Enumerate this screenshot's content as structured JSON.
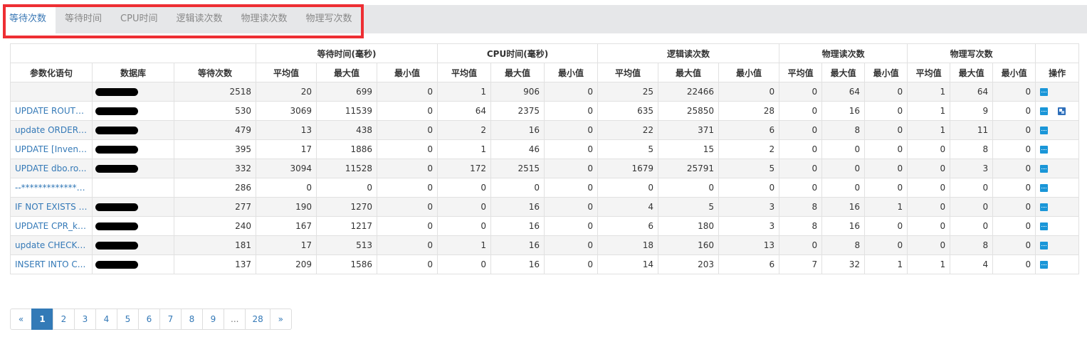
{
  "tabs": [
    {
      "label": "等待次数",
      "active": true
    },
    {
      "label": "等待时间",
      "active": false
    },
    {
      "label": "CPU时间",
      "active": false
    },
    {
      "label": "逻辑读次数",
      "active": false
    },
    {
      "label": "物理读次数",
      "active": false
    },
    {
      "label": "物理写次数",
      "active": false
    }
  ],
  "table": {
    "group_headers": {
      "wait_time": "等待时间(毫秒)",
      "cpu_time": "CPU时间(毫秒)",
      "logical_reads": "逻辑读次数",
      "physical_reads": "物理读次数",
      "physical_writes": "物理写次数"
    },
    "headers": {
      "sql": "参数化语句",
      "db": "数据库",
      "wait_count": "等待次数",
      "avg": "平均值",
      "max": "最大值",
      "min": "最小值",
      "ops": "操作"
    },
    "rows": [
      {
        "sql": "",
        "db_redacted": true,
        "vals": [
          "2518",
          "20",
          "699",
          "0",
          "1",
          "906",
          "0",
          "25",
          "22466",
          "0",
          "0",
          "64",
          "0",
          "1",
          "64",
          "0"
        ],
        "extra_op": false
      },
      {
        "sql": "UPDATE ROUTE...",
        "db_redacted": true,
        "vals": [
          "530",
          "3069",
          "11539",
          "0",
          "64",
          "2375",
          "0",
          "635",
          "25850",
          "28",
          "0",
          "16",
          "0",
          "1",
          "9",
          "0"
        ],
        "extra_op": true
      },
      {
        "sql": "update ORDER_...",
        "db_redacted": true,
        "vals": [
          "479",
          "13",
          "438",
          "0",
          "2",
          "16",
          "0",
          "22",
          "371",
          "6",
          "0",
          "8",
          "0",
          "1",
          "11",
          "0"
        ],
        "extra_op": false
      },
      {
        "sql": "UPDATE [Invent...",
        "db_redacted": true,
        "vals": [
          "395",
          "17",
          "1886",
          "0",
          "1",
          "46",
          "0",
          "5",
          "15",
          "2",
          "0",
          "0",
          "0",
          "0",
          "8",
          "0"
        ],
        "extra_op": false
      },
      {
        "sql": "UPDATE dbo.ro...",
        "db_redacted": true,
        "vals": [
          "332",
          "3094",
          "11528",
          "0",
          "172",
          "2515",
          "0",
          "1679",
          "25791",
          "5",
          "0",
          "0",
          "0",
          "0",
          "3",
          "0"
        ],
        "extra_op": false
      },
      {
        "sql": "--****************...",
        "db_redacted": false,
        "vals": [
          "286",
          "0",
          "0",
          "0",
          "0",
          "0",
          "0",
          "0",
          "0",
          "0",
          "0",
          "0",
          "0",
          "0",
          "0",
          "0"
        ],
        "extra_op": false
      },
      {
        "sql": "IF NOT EXISTS (...",
        "db_redacted": true,
        "vals": [
          "277",
          "190",
          "1270",
          "0",
          "0",
          "16",
          "0",
          "4",
          "5",
          "3",
          "8",
          "16",
          "1",
          "0",
          "0",
          "0"
        ],
        "extra_op": false
      },
      {
        "sql": "UPDATE CPR_ks...",
        "db_redacted": true,
        "vals": [
          "240",
          "167",
          "1217",
          "0",
          "0",
          "16",
          "0",
          "6",
          "180",
          "3",
          "8",
          "16",
          "0",
          "0",
          "0",
          "0"
        ],
        "extra_op": false
      },
      {
        "sql": "update CHECK_...",
        "db_redacted": true,
        "vals": [
          "181",
          "17",
          "513",
          "0",
          "1",
          "16",
          "0",
          "18",
          "160",
          "13",
          "0",
          "8",
          "0",
          "0",
          "8",
          "0"
        ],
        "extra_op": false
      },
      {
        "sql": "INSERT INTO C...",
        "db_redacted": true,
        "vals": [
          "137",
          "209",
          "1586",
          "0",
          "0",
          "16",
          "0",
          "14",
          "203",
          "6",
          "7",
          "32",
          "1",
          "1",
          "4",
          "0"
        ],
        "extra_op": false
      }
    ]
  },
  "pagination": {
    "items": [
      {
        "label": "«",
        "type": "prev"
      },
      {
        "label": "1",
        "type": "page",
        "active": true
      },
      {
        "label": "2",
        "type": "page"
      },
      {
        "label": "3",
        "type": "page"
      },
      {
        "label": "4",
        "type": "page"
      },
      {
        "label": "5",
        "type": "page"
      },
      {
        "label": "6",
        "type": "page"
      },
      {
        "label": "7",
        "type": "page"
      },
      {
        "label": "8",
        "type": "page"
      },
      {
        "label": "9",
        "type": "page"
      },
      {
        "label": "...",
        "type": "ellipsis"
      },
      {
        "label": "28",
        "type": "page"
      },
      {
        "label": "»",
        "type": "next"
      }
    ]
  },
  "icons": {
    "detail": "ellipsis-icon",
    "extra": "window-restore-icon"
  },
  "colors": {
    "accent": "#3479b7",
    "highlight_border": "#ee2e33",
    "op_button": "#1a96d8",
    "active_page": "#337ab7"
  }
}
